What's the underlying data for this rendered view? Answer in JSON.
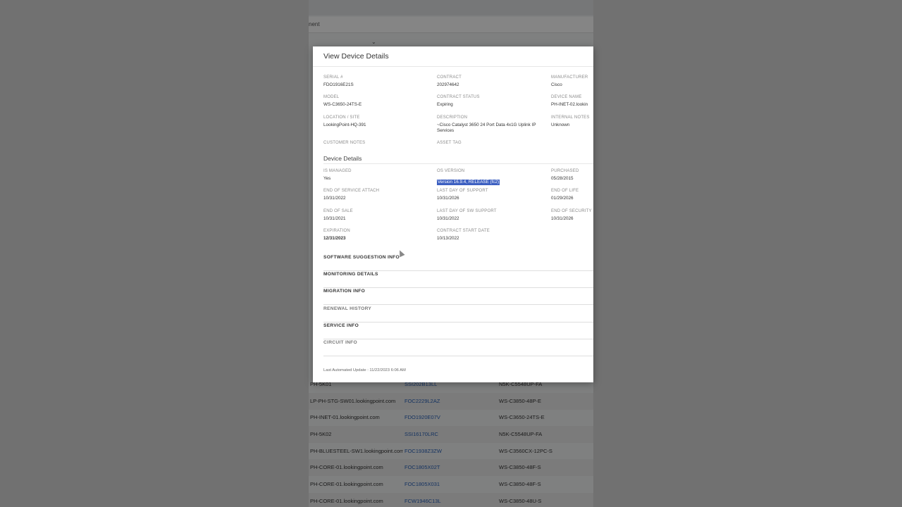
{
  "background": {
    "subbar_text": "nent",
    "rows": [
      {
        "name": "PH-5K01",
        "serial": "SSI202B13LL",
        "model": "N5K-C5548UP-FA"
      },
      {
        "name": "LP-PH-STG-SW01.lookingpoint.com",
        "serial": "FOC2229L2AZ",
        "model": "WS-C3850-48P-E"
      },
      {
        "name": "PH-INET-01.lookingpoint.com",
        "serial": "FDO1920E07V",
        "model": "WS-C3650-24TS-E"
      },
      {
        "name": "PH-5K02",
        "serial": "SSI16170LRC",
        "model": "N5K-C5548UP-FA"
      },
      {
        "name": "PH-BLUESTEEL-SW1.lookingpoint.com",
        "serial": "FOC1938Z3ZW",
        "model": "WS-C3560CX-12PC-S"
      },
      {
        "name": "PH-CORE-01.lookingpoint.com",
        "serial": "FOC1805X02T",
        "model": "WS-C3850-48F-S"
      },
      {
        "name": "PH-CORE-01.lookingpoint.com",
        "serial": "FOC1805X031",
        "model": "WS-C3850-48F-S"
      },
      {
        "name": "PH-CORE-01.lookingpoint.com",
        "serial": "FCW1946C13L",
        "model": "WS-C3850-48U-S"
      }
    ]
  },
  "modal": {
    "title": "View Device Details",
    "fields": {
      "serial_label": "SERIAL #",
      "serial_value": "FDO1916E21S",
      "contract_label": "CONTRACT",
      "contract_value": "202974642",
      "manufacturer_label": "MANUFACTURER",
      "manufacturer_value": "Cisco",
      "model_label": "MODEL",
      "model_value": "WS-C3650-24TS-E",
      "contract_status_label": "CONTRACT STATUS",
      "contract_status_value": "Expiring",
      "device_name_label": "DEVICE NAME",
      "device_name_value": "PH-INET-02.lookin",
      "location_label": "LOCATION / SITE",
      "location_value": "LookingPoint-HQ-391",
      "description_label": "DESCRIPTION",
      "description_value": "~Cisco Catalyst 3650 24 Port Data 4x1G Uplink IP Services",
      "internal_notes_label": "INTERNAL NOTES",
      "internal_notes_value": "Unknown",
      "customer_notes_label": "CUSTOMER NOTES",
      "asset_tag_label": "ASSET TAG"
    },
    "device_details": {
      "title": "Device Details",
      "is_managed_label": "IS MANAGED",
      "is_managed_value": "Yes",
      "os_version_label": "OS VERSION",
      "os_version_value": "Version 16.9.4, RELEASE (fc2)",
      "purchased_label": "PURCHASED",
      "purchased_value": "05/28/2015",
      "eosa_label": "END OF SERVICE ATTACH",
      "eosa_value": "10/31/2022",
      "ldos_label": "LAST DAY OF SUPPORT",
      "ldos_value": "10/31/2026",
      "eol_label": "END OF LIFE",
      "eol_value": "01/29/2026",
      "eos_label": "END OF SALE",
      "eos_value": "10/31/2021",
      "ldsw_label": "LAST DAY OF SW SUPPORT",
      "ldsw_value": "10/31/2022",
      "eosec_label": "END OF SECURITY",
      "eosec_value": "10/31/2026",
      "expiration_label": "EXPIRATION",
      "expiration_value": "12/31/2023",
      "contract_start_label": "CONTRACT START DATE",
      "contract_start_value": "10/13/2022"
    },
    "accordions": [
      "SOFTWARE SUGGESTION INFO",
      "MONITORING DETAILS",
      "MIGRATION INFO",
      "RENEWAL HISTORY",
      "SERVICE INFO",
      "CIRCUIT INFO"
    ],
    "footer": "Last Automated Update : 11/22/2023 6:06 AM"
  },
  "colors": {
    "selection": "#3c5fc1",
    "link": "#2a62b9"
  }
}
